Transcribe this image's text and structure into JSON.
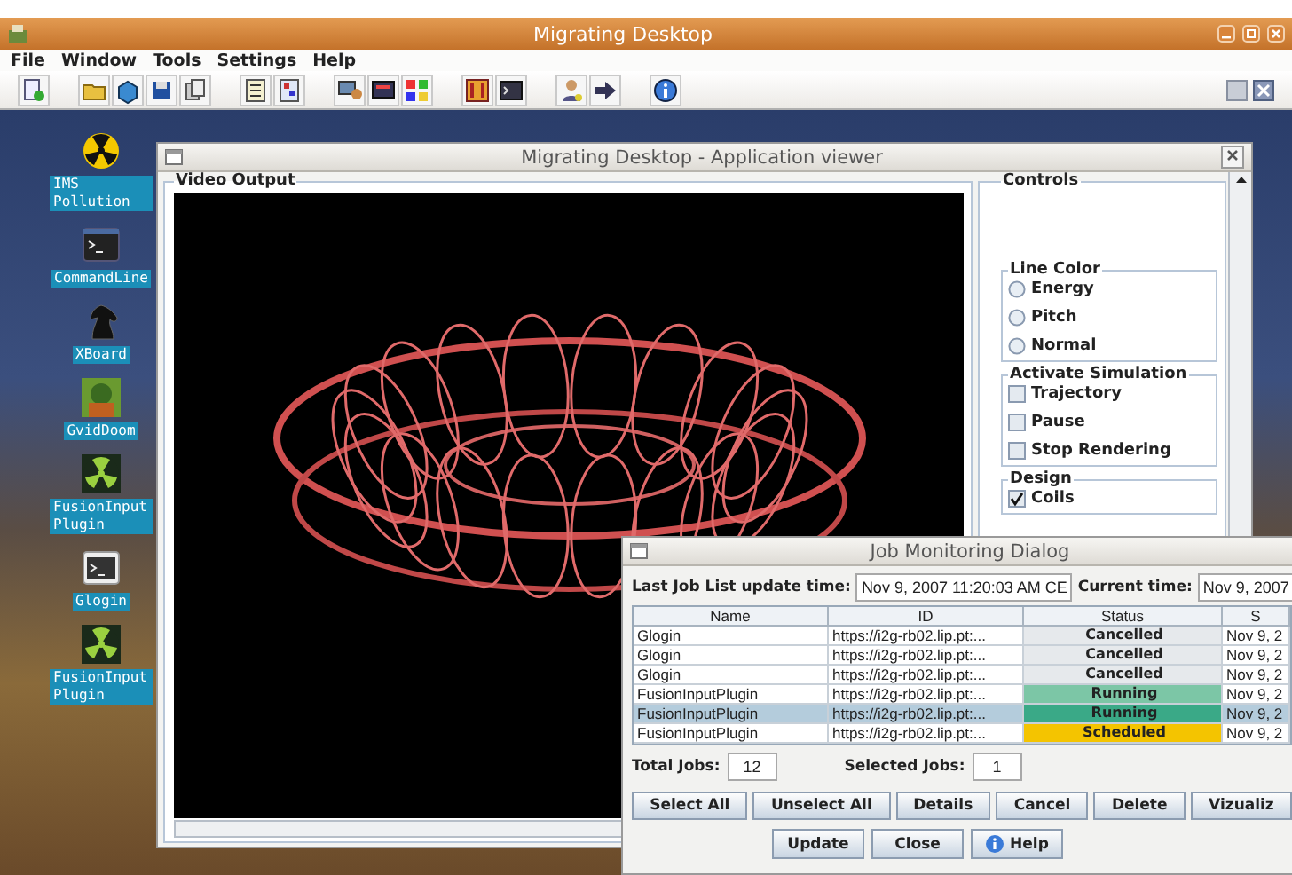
{
  "window": {
    "title": "Migrating Desktop",
    "menu": [
      {
        "label": "File"
      },
      {
        "label": "Window"
      },
      {
        "label": "Tools"
      },
      {
        "label": "Settings"
      },
      {
        "label": "Help"
      }
    ]
  },
  "desktop_icons": [
    {
      "label": "IMS Pollution",
      "kind": "radiation"
    },
    {
      "label": "CommandLine",
      "kind": "terminal"
    },
    {
      "label": "XBoard",
      "kind": "knight"
    },
    {
      "label": "GvidDoom",
      "kind": "picture"
    },
    {
      "label": "FusionInputPlugin",
      "kind": "radiation-green"
    },
    {
      "label": "Glogin",
      "kind": "terminal-light"
    },
    {
      "label": "FusionInputPlugin",
      "kind": "radiation-green"
    }
  ],
  "viewer": {
    "title": "Migrating Desktop - Application viewer",
    "video_panel": {
      "title": "Video Output"
    },
    "controls": {
      "title": "Controls",
      "groups": [
        {
          "title": "Line Color",
          "kind": "radio",
          "items": [
            {
              "label": "Energy",
              "selected": false
            },
            {
              "label": "Pitch",
              "selected": false
            },
            {
              "label": "Normal",
              "selected": false
            }
          ]
        },
        {
          "title": "Activate Simulation",
          "kind": "checkbox",
          "items": [
            {
              "label": "Trajectory",
              "checked": false
            },
            {
              "label": "Pause",
              "checked": false
            },
            {
              "label": "Stop Rendering",
              "checked": false
            }
          ]
        },
        {
          "title": "Design",
          "kind": "checkbox",
          "items": [
            {
              "label": "Coils",
              "checked": true
            }
          ]
        }
      ]
    }
  },
  "job_dialog": {
    "title": "Job Monitoring Dialog",
    "last_update_label": "Last Job List update time:",
    "last_update_value": "Nov 9, 2007 11:20:03 AM CE",
    "current_time_label": "Current time:",
    "current_time_value": "Nov 9, 2007",
    "table": {
      "columns": [
        "Name",
        "ID",
        "Status",
        "S"
      ],
      "rows": [
        {
          "name": "Glogin",
          "id": "https://i2g-rb02.lip.pt:...",
          "status": "Cancelled",
          "color": "#e6e9ec",
          "column_4": "Nov 9, 2",
          "selected": false
        },
        {
          "name": "Glogin",
          "id": "https://i2g-rb02.lip.pt:...",
          "status": "Cancelled",
          "color": "#e6e9ec",
          "column_4": "Nov 9, 2",
          "selected": false
        },
        {
          "name": "Glogin",
          "id": "https://i2g-rb02.lip.pt:...",
          "status": "Cancelled",
          "color": "#e6e9ec",
          "column_4": "Nov 9, 2",
          "selected": false
        },
        {
          "name": "FusionInputPlugin",
          "id": "https://i2g-rb02.lip.pt:...",
          "status": "Running",
          "color": "#7cc6a6",
          "column_4": "Nov 9, 2",
          "selected": false
        },
        {
          "name": "FusionInputPlugin",
          "id": "https://i2g-rb02.lip.pt:...",
          "status": "Running",
          "color": "#3aa987",
          "column_4": "Nov 9, 2",
          "selected": true
        },
        {
          "name": "FusionInputPlugin",
          "id": "https://i2g-rb02.lip.pt:...",
          "status": "Scheduled",
          "color": "#f4c400",
          "column_4": "Nov 9, 2",
          "selected": false
        }
      ]
    },
    "total_label": "Total Jobs:",
    "total_value": "12",
    "selected_label": "Selected Jobs:",
    "selected_value": "1",
    "actions": [
      {
        "label": "Select All"
      },
      {
        "label": "Unselect All"
      },
      {
        "label": "Details"
      },
      {
        "label": "Cancel"
      },
      {
        "label": "Delete"
      },
      {
        "label": "Vizualiz"
      }
    ],
    "footer_buttons": [
      {
        "label": "Update",
        "kind": "plain"
      },
      {
        "label": "Close",
        "kind": "plain"
      },
      {
        "label": "Help",
        "kind": "help"
      }
    ]
  }
}
